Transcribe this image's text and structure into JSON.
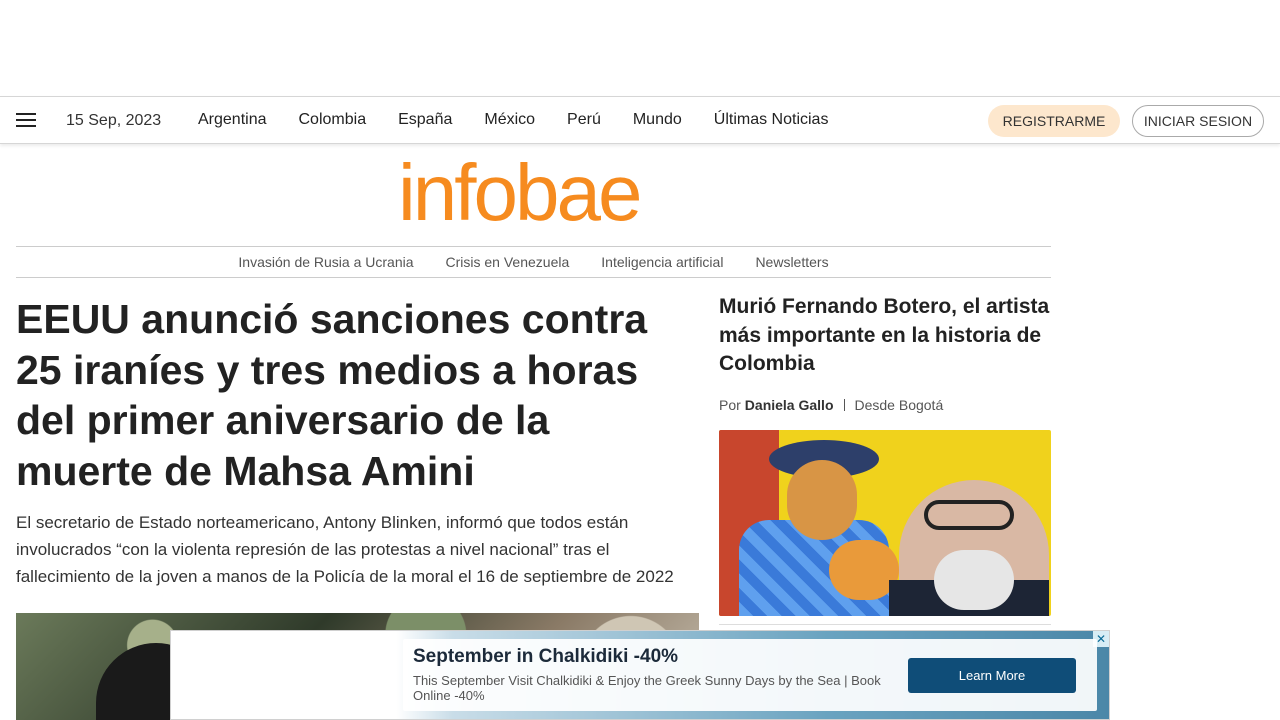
{
  "header": {
    "date": "15 Sep, 2023",
    "nav": [
      "Argentina",
      "Colombia",
      "España",
      "México",
      "Perú",
      "Mundo",
      "Últimas Noticias"
    ],
    "register_label": "REGISTRARME",
    "login_label": "INICIAR SESION"
  },
  "brand": {
    "logo_text": "infobae",
    "color": "#f68b1f"
  },
  "subnav": [
    "Invasión de Rusia a Ucrania",
    "Crisis en Venezuela",
    "Inteligencia artificial",
    "Newsletters"
  ],
  "main_story": {
    "headline": "EEUU anunció sanciones contra 25 iraníes y tres medios a horas del primer aniversario de la muerte de Mahsa Amini",
    "lede": "El secretario de Estado norteamericano, Antony Blinken, informó que todos están involucrados “con la violenta represión de las protestas a nivel nacional” tras el fallecimiento de la joven a manos de la Policía de la moral el 16 de septiembre de 2022"
  },
  "side_story": {
    "headline": "Murió Fernando Botero, el artista más importante en la historia de Colombia",
    "by_prefix": "Por",
    "author": "Daniela Gallo",
    "location": "Desde Bogotá"
  },
  "ad": {
    "title": "September in Chalkidiki -40%",
    "text": "This September Visit Chalkidiki & Enjoy the Greek Sunny Days by the Sea | Book Online -40%",
    "button_label": "Learn More",
    "close_symbol": "✕"
  }
}
